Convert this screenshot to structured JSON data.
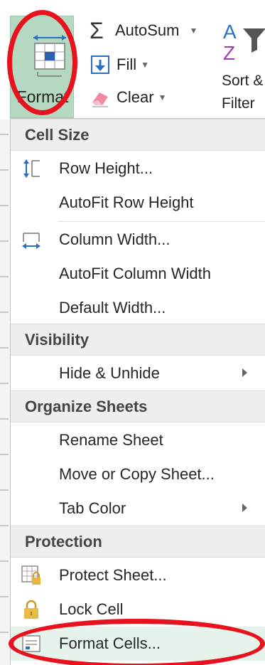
{
  "ribbon": {
    "format_label": "Format",
    "autosum_label": "AutoSum",
    "fill_label": "Fill",
    "clear_label": "Clear",
    "sort_label": "Sort &",
    "filter_label": "Filter"
  },
  "menu": {
    "sections": {
      "cell_size": "Cell Size",
      "visibility": "Visibility",
      "organize_sheets": "Organize Sheets",
      "protection": "Protection"
    },
    "items": {
      "row_height": "Row Height...",
      "autofit_row_height": "AutoFit Row Height",
      "column_width": "Column Width...",
      "autofit_column_width": "AutoFit Column Width",
      "default_width": "Default Width...",
      "hide_unhide": "Hide & Unhide",
      "rename_sheet": "Rename Sheet",
      "move_copy_sheet": "Move or Copy Sheet...",
      "tab_color": "Tab Color",
      "protect_sheet": "Protect Sheet...",
      "lock_cell": "Lock Cell",
      "format_cells": "Format Cells..."
    }
  },
  "colors": {
    "format_button_bg": "#b4d9c0",
    "annotation_ring": "#e8111e",
    "section_header_bg": "#eeeeee",
    "highlight_bg": "#e6f3ea"
  }
}
